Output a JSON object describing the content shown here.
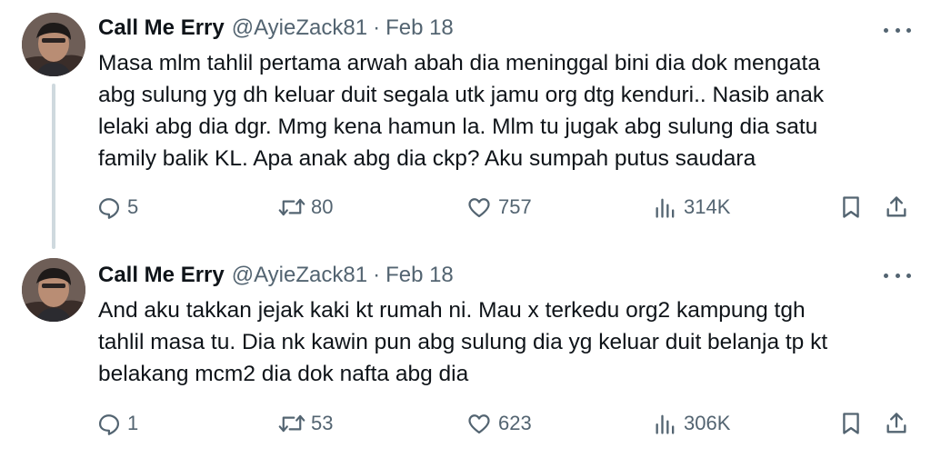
{
  "tweets": [
    {
      "author": {
        "display_name": "Call Me Erry",
        "handle": "@AyieZack81"
      },
      "separator": "·",
      "date": "Feb 18",
      "text_lines": [
        "Masa mlm tahlil pertama arwah abah dia meninggal bini dia dok mengata",
        "abg sulung yg dh keluar duit segala utk jamu org dtg kenduri.. Nasib anak",
        "lelaki abg dia dgr. Mmg kena hamun la. Mlm tu jugak abg sulung dia satu",
        "family balik KL. Apa anak abg dia ckp? Aku sumpah putus saudara"
      ],
      "stats": {
        "replies": "5",
        "reposts": "80",
        "likes": "757",
        "views": "314K"
      }
    },
    {
      "author": {
        "display_name": "Call Me Erry",
        "handle": "@AyieZack81"
      },
      "separator": "·",
      "date": "Feb 18",
      "text_lines": [
        "And aku takkan jejak kaki kt rumah ni. Mau x terkedu org2 kampung tgh",
        "tahlil masa tu. Dia nk kawin pun abg sulung dia yg keluar duit belanja tp kt",
        "belakang mcm2 dia dok nafta abg dia"
      ],
      "stats": {
        "replies": "1",
        "reposts": "53",
        "likes": "623",
        "views": "306K"
      }
    }
  ],
  "icons": {
    "reply": "reply-icon",
    "repost": "repost-icon",
    "like": "heart-icon",
    "views": "views-icon",
    "bookmark": "bookmark-icon",
    "share": "share-icon",
    "more": "more-icon"
  },
  "colors": {
    "text": "#0f1419",
    "secondary": "#536471",
    "thread_line": "#cfd9de",
    "background": "#ffffff"
  }
}
